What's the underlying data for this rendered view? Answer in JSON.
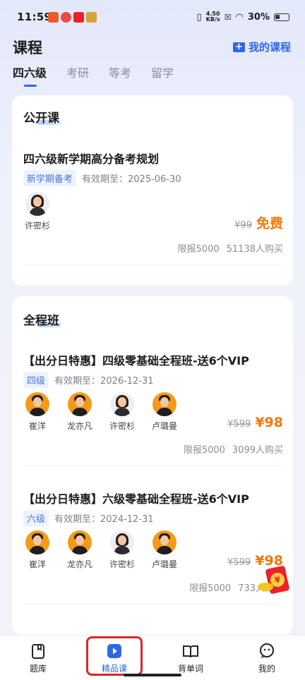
{
  "status_bar": {
    "time": "11:59",
    "net_speed_value": "4.50",
    "net_speed_unit": "KB/s",
    "battery": "30%"
  },
  "header": {
    "title": "课程",
    "my_courses_label": "我的课程",
    "my_courses_icon": "folder-plus-icon"
  },
  "tabs": [
    {
      "label": "四六级",
      "active": true
    },
    {
      "label": "考研",
      "active": false
    },
    {
      "label": "等考",
      "active": false
    },
    {
      "label": "留学",
      "active": false
    }
  ],
  "sections": [
    {
      "title": "公开课",
      "courses": [
        {
          "title": "四六级新学期高分备考规划",
          "tag": "新学期备考",
          "validity": "有效期至：2025-06-30",
          "teachers": [
            "许密杉"
          ],
          "old_price": "¥99",
          "new_price": "免费",
          "limit": "限报5000",
          "buyers": "51138人购买"
        }
      ]
    },
    {
      "title": "全程班",
      "courses": [
        {
          "title": "【出分日特惠】四级零基础全程班-送6个VIP",
          "tag": "四级",
          "validity": "有效期至：2026-12-31",
          "teachers": [
            "崔洋",
            "龙亦凡",
            "许密杉",
            "卢璐曼"
          ],
          "old_price": "¥599",
          "new_price": "¥98",
          "limit": "限报5000",
          "buyers": "3099人购买"
        },
        {
          "title": "【出分日特惠】六级零基础全程班-送6个VIP",
          "tag": "六级",
          "validity": "有效期至：2024-12-31",
          "teachers": [
            "崔洋",
            "龙亦凡",
            "许密杉",
            "卢璐曼"
          ],
          "old_price": "¥599",
          "new_price": "¥98",
          "limit": "限报5000",
          "buyers": "733人购买"
        }
      ]
    }
  ],
  "bottom_nav": [
    {
      "label": "题库",
      "icon": "question-bank-icon",
      "active": false
    },
    {
      "label": "精品课",
      "icon": "play-video-icon",
      "active": true
    },
    {
      "label": "背单词",
      "icon": "book-icon",
      "active": false
    },
    {
      "label": "我的",
      "icon": "profile-chat-icon",
      "active": false
    }
  ],
  "colors": {
    "accent": "#2f66e8",
    "price": "#f4780b",
    "highlight_box": "#d9262b"
  }
}
